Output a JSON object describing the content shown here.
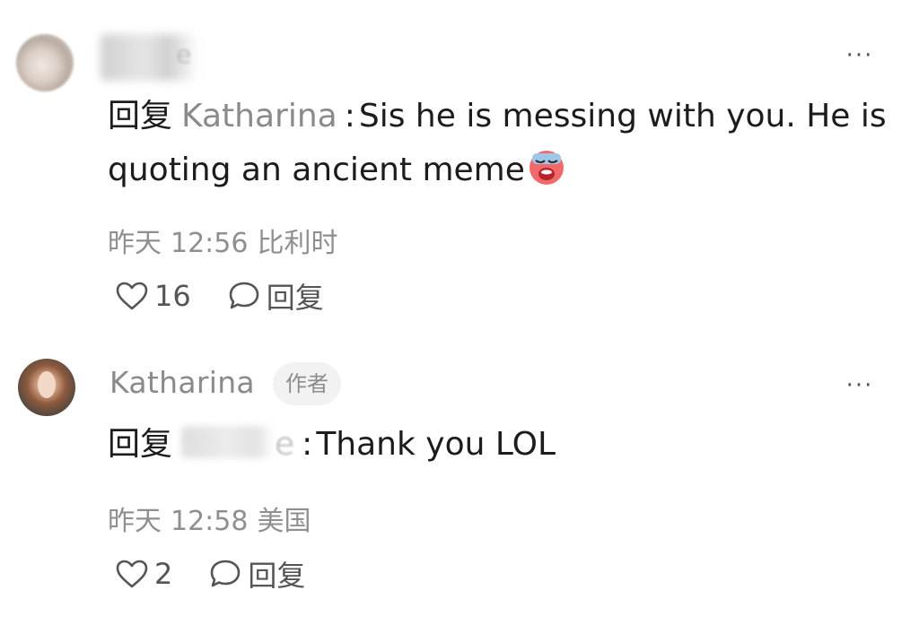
{
  "comments": [
    {
      "username": "",
      "username_tail": "e",
      "reply_prefix": "回复",
      "reply_target": "Katharina",
      "separator": ":",
      "text_line1": "Sis he is messing with you. He is",
      "text_line2": "quoting an ancient meme",
      "date": "昨天",
      "time": "12:56",
      "location": "比利时",
      "likes": "16",
      "reply_label": "回复",
      "more": "···"
    },
    {
      "username": "Katharina",
      "badge": "作者",
      "reply_prefix": "回复",
      "reply_target_tail": "e",
      "separator": ":",
      "text": "Thank you LOL",
      "date": "昨天",
      "time": "12:58",
      "location": "美国",
      "likes": "2",
      "reply_label": "回复",
      "more": "···"
    }
  ],
  "icons": {
    "like": "heart-outline-icon",
    "reply": "chat-bubble-icon",
    "more": "ellipsis-icon",
    "emoji": "crying-face-emoji-icon"
  },
  "colors": {
    "primary_text": "#1c1c1c",
    "secondary_text": "#8a8a8a",
    "badge_bg": "#f2f2f2"
  }
}
